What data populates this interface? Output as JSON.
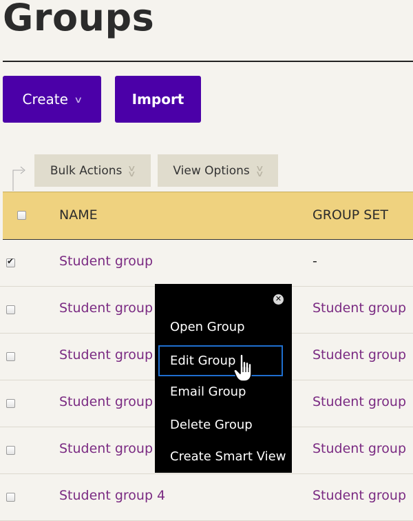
{
  "page": {
    "title": "Groups"
  },
  "toolbar": {
    "create_label": "Create",
    "import_label": "Import",
    "bulk_actions_label": "Bulk Actions",
    "view_options_label": "View Options"
  },
  "table": {
    "columns": [
      "NAME",
      "GROUP SET"
    ],
    "rows": [
      {
        "name": "Student group",
        "group_set": "-",
        "checked": true
      },
      {
        "name": "Student group",
        "group_set": "Student group",
        "checked": false
      },
      {
        "name": "Student group",
        "group_set": "Student group",
        "checked": false
      },
      {
        "name": "Student group",
        "group_set": "Student group",
        "checked": false
      },
      {
        "name": "Student group",
        "group_set": "Student group",
        "checked": false
      },
      {
        "name": "Student group 4",
        "group_set": "Student group",
        "checked": false
      }
    ]
  },
  "context_menu": {
    "items": [
      {
        "label": "Open Group",
        "focused": false
      },
      {
        "label": "Edit Group",
        "focused": true
      },
      {
        "label": "Email Group",
        "focused": false
      },
      {
        "label": "Delete Group",
        "focused": false
      },
      {
        "label": "Create Smart View",
        "focused": false
      }
    ]
  },
  "colors": {
    "primary_button": "#4b00a8",
    "header_band": "#efd27f",
    "link": "#7a2a82",
    "focus_ring": "#1f6fd0"
  }
}
